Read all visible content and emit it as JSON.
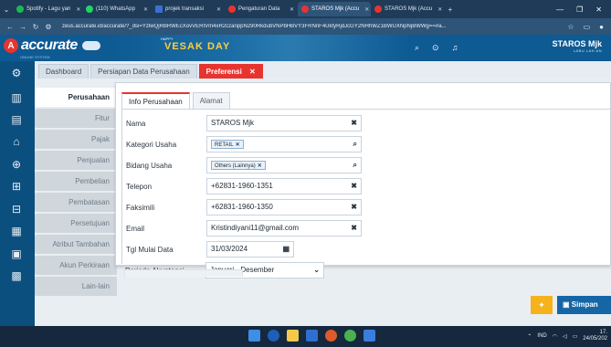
{
  "browser": {
    "tabs": [
      {
        "label": "Spotify - Lagu yan",
        "color": "#1db954"
      },
      {
        "label": "(110) WhatsApp",
        "color": "#25d366"
      },
      {
        "label": "projek transaksi",
        "color": "#3b6fd6"
      },
      {
        "label": "Pengaturan Data",
        "color": "#e8342f"
      },
      {
        "label": "STAROS Mjk (Accu",
        "color": "#e8342f"
      },
      {
        "label": "STAROS Mjk (Accu",
        "color": "#e8342f"
      }
    ],
    "url": "zeus.accurate.id/accurate/?_dsi=YzlwQjRBRWEcXovVERIVm4xR2czanppN290RkdubVNPbHBVY3FRNnF4UktyRjdJcGY2NHhWZ1BWUXNpNjBWWg==#a..."
  },
  "app": {
    "logo_text": "accurate",
    "logo_sub": "ONLINE SYSTEM",
    "banner_title": "VESAK DAY",
    "banner_sub": "HAPPY",
    "company_name": "STAROS Mjk",
    "company_role": "LABU LAH AN"
  },
  "page_tabs": {
    "dashboard": "Dashboard",
    "persiapan": "Persiapan Data Perusahaan",
    "preferensi": "Preferensi",
    "close": "✕"
  },
  "side_menu": [
    "Perusahaan",
    "Fitur",
    "Pajak",
    "Penjualan",
    "Pembelian",
    "Pembatasan",
    "Persetujuan",
    "Atribut Tambahan",
    "Akun Perkiraan",
    "Lain-lain"
  ],
  "inner_tabs": {
    "info": "Info Perusahaan",
    "alamat": "Alamat"
  },
  "form": {
    "nama_label": "Nama",
    "nama_value": "STAROS Mjk",
    "kategori_label": "Kategori Usaha",
    "kategori_tag": "RETAIL",
    "bidang_label": "Bidang Usaha",
    "bidang_tag": "Others (Lainnya)",
    "telepon_label": "Telepon",
    "telepon_value": "+62831-1960-1351",
    "faksimili_label": "Faksimili",
    "faksimili_value": "+62831-1960-1350",
    "email_label": "Email",
    "email_value": "Kristindiyani11@gmail.com",
    "tgl_label": "Tgl Mulai Data",
    "tgl_value": "31/03/2024",
    "periode_label": "Periode Akuntansi",
    "periode_value": "Januari - Desember"
  },
  "buttons": {
    "save": "Simpan"
  },
  "taskbar": {
    "lang": "IND",
    "time": "17.",
    "date": "24/05/202"
  }
}
